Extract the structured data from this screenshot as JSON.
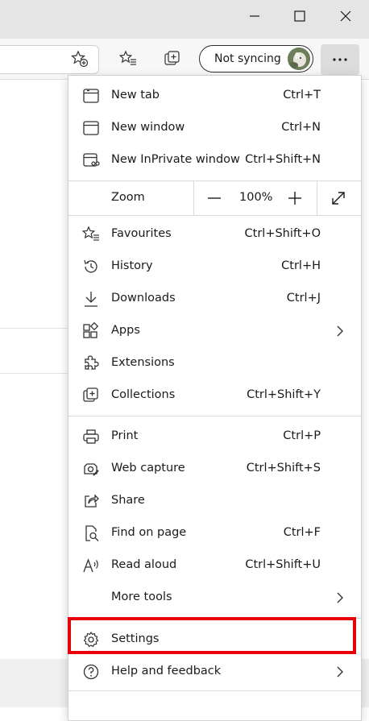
{
  "window": {
    "minimize_icon": "minimize-icon",
    "maximize_icon": "maximize-icon",
    "close_icon": "close-icon"
  },
  "toolbar": {
    "sync_label": "Not syncing",
    "more_icon": "more-dots-icon"
  },
  "menu": {
    "group1": [
      {
        "label": "New tab",
        "shortcut": "Ctrl+T",
        "icon": "new-tab-icon"
      },
      {
        "label": "New window",
        "shortcut": "Ctrl+N",
        "icon": "new-window-icon"
      },
      {
        "label": "New InPrivate window",
        "shortcut": "Ctrl+Shift+N",
        "icon": "inprivate-icon"
      }
    ],
    "zoom": {
      "label": "Zoom",
      "value": "100%"
    },
    "group2": [
      {
        "label": "Favourites",
        "shortcut": "Ctrl+Shift+O",
        "icon": "favourites-icon"
      },
      {
        "label": "History",
        "shortcut": "Ctrl+H",
        "icon": "history-icon"
      },
      {
        "label": "Downloads",
        "shortcut": "Ctrl+J",
        "icon": "download-icon"
      },
      {
        "label": "Apps",
        "shortcut": "",
        "icon": "apps-icon"
      },
      {
        "label": "Extensions",
        "shortcut": "",
        "icon": "extensions-icon"
      },
      {
        "label": "Collections",
        "shortcut": "Ctrl+Shift+Y",
        "icon": "collections-icon"
      }
    ],
    "group3": [
      {
        "label": "Print",
        "shortcut": "Ctrl+P",
        "icon": "print-icon"
      },
      {
        "label": "Web capture",
        "shortcut": "Ctrl+Shift+S",
        "icon": "web-capture-icon"
      },
      {
        "label": "Share",
        "shortcut": "",
        "icon": "share-icon"
      },
      {
        "label": "Find on page",
        "shortcut": "Ctrl+F",
        "icon": "find-icon"
      },
      {
        "label": "Read aloud",
        "shortcut": "Ctrl+Shift+U",
        "icon": "read-aloud-icon"
      },
      {
        "label": "More tools",
        "shortcut": "",
        "icon": ""
      }
    ],
    "group4": [
      {
        "label": "Settings",
        "shortcut": "",
        "icon": "gear-icon"
      },
      {
        "label": "Help and feedback",
        "shortcut": "",
        "icon": "help-icon"
      }
    ]
  },
  "colors": {
    "highlight": "#e8000b",
    "titlebar": "#e5e5e5"
  }
}
